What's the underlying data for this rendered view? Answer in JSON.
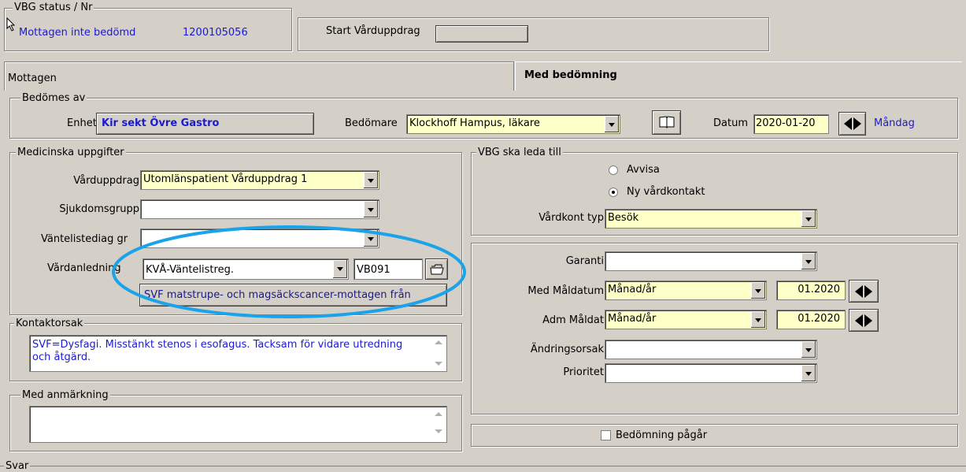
{
  "status": {
    "legend": "VBG status / Nr",
    "status_text": "Mottagen inte bedömd",
    "number": "1200105056",
    "start_label": "Start Vårduppdrag"
  },
  "tabs": [
    {
      "label": "Mottagen"
    },
    {
      "label": "Med bedömning"
    }
  ],
  "bedomes": {
    "legend": "Bedömes av",
    "enhet_label": "Enhet",
    "enhet_value": "Kir sekt Övre Gastro",
    "bedomare_label": "Bedömare",
    "bedomare_value": "Klockhoff Hampus, läkare",
    "datum_label": "Datum",
    "datum_value": "2020-01-20",
    "day": "Måndag"
  },
  "medicinska": {
    "legend": "Medicinska uppgifter",
    "varduppdrag_label": "Vårduppdrag",
    "varduppdrag_value": "Utomlänspatient Vårduppdrag 1",
    "sjukdomsgrupp_label": "Sjukdomsgrupp",
    "vantelistediag_label": "Väntelistediag gr",
    "vardanledning_label": "Vårdanledning",
    "vardanledning_value": "KVÅ-Väntelistreg.",
    "code_value": "VB091",
    "svf_value": "SVF matstrupe- och magsäckscancer-mottagen från"
  },
  "kontaktorsak": {
    "legend": "Kontaktorsak",
    "text": "SVF=Dysfagi. Misstänkt stenos i esofagus. Tacksam för vidare utredning och åtgärd."
  },
  "med_anmarkning": {
    "legend": "Med anmärkning"
  },
  "vbg_leda": {
    "legend": "VBG ska leda till",
    "avvisa": "Avvisa",
    "ny_vardkontakt": "Ny vårdkontakt",
    "vardkont_label": "Vårdkont typ",
    "vardkont_value": "Besök"
  },
  "garanti": {
    "garanti_label": "Garanti",
    "med_maldatum_label": "Med Måldatum",
    "med_maldatum_value": "Månad/år",
    "med_maldatum_date": "01.2020",
    "adm_maldat_label": "Adm Måldat",
    "adm_maldat_value": "Månad/år",
    "adm_maldat_date": "01.2020",
    "andringsorsak_label": "Ändringsorsak",
    "prioritet_label": "Prioritet"
  },
  "bedomning_pagar": "Bedömning pågår",
  "svar": {
    "legend": "Svar"
  },
  "colors": {
    "highlight_ellipse": "#1aa3e8",
    "blue_text": "#1a1ad0",
    "yellow_field": "#ffffc8"
  }
}
